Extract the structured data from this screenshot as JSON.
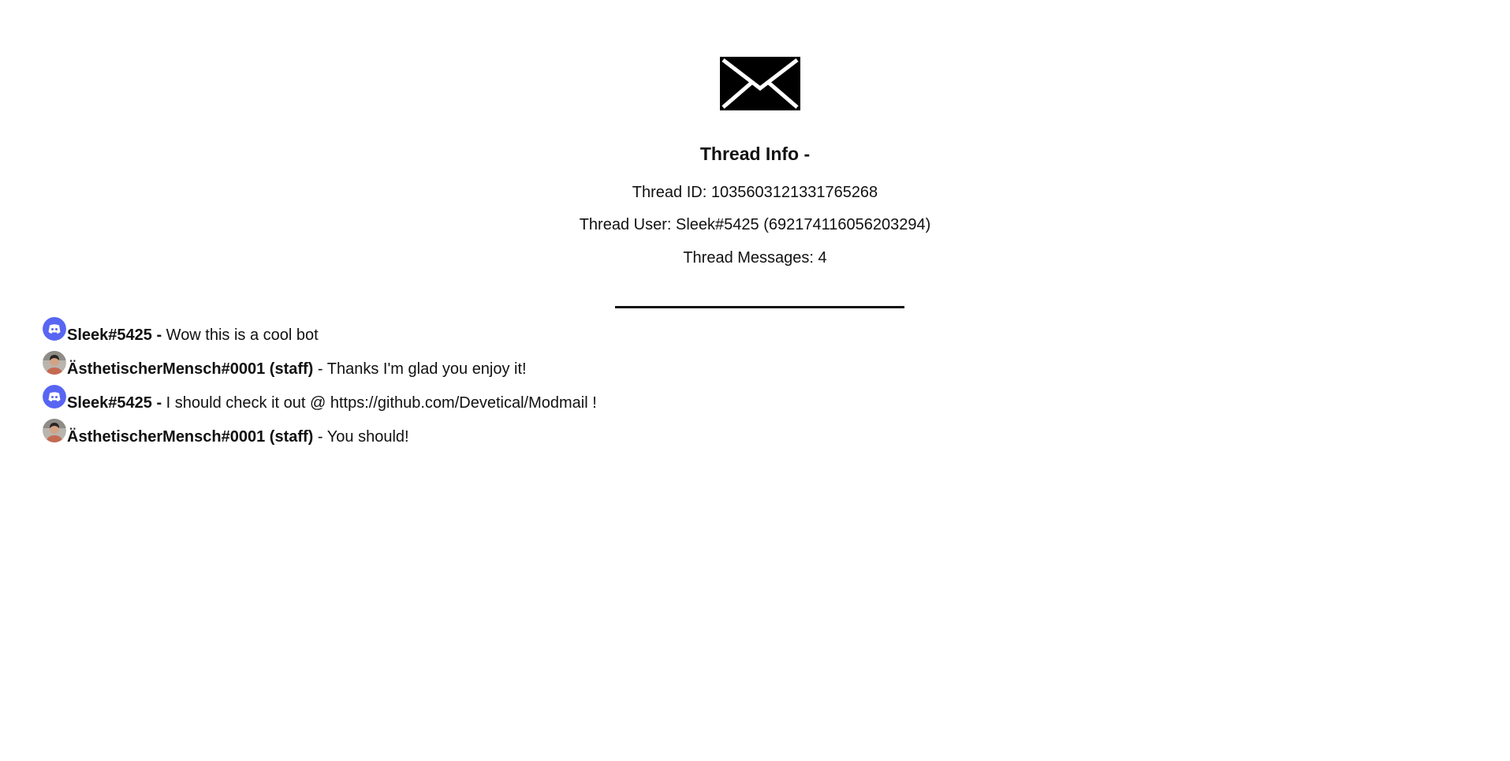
{
  "header": {
    "icon": "envelope-icon",
    "title": "Thread Info -",
    "thread_id_label": "Thread ID:",
    "thread_id": "1035603121331765268",
    "thread_user_label": "Thread User:",
    "thread_user": "Sleek#5425 (692174116056203294)",
    "thread_messages_label": "Thread Messages:",
    "thread_messages": "4"
  },
  "colors": {
    "text": "#111111",
    "discord_blurple": "#5865F2",
    "background": "#ffffff"
  },
  "messages": [
    {
      "avatar": "discord-default-avatar-icon",
      "author": "Sleek#5425 -",
      "content": "Wow this is a cool bot"
    },
    {
      "avatar": "user-photo-avatar",
      "author": "ÄsthetischerMensch#0001 (staff)",
      "separator": "-",
      "content": "Thanks I'm glad you enjoy it!"
    },
    {
      "avatar": "discord-default-avatar-icon",
      "author": "Sleek#5425 -",
      "content": "I should check it out @ https://github.com/Devetical/Modmail !"
    },
    {
      "avatar": "user-photo-avatar",
      "author": "ÄsthetischerMensch#0001 (staff)",
      "separator": "-",
      "content": "You should!"
    }
  ]
}
